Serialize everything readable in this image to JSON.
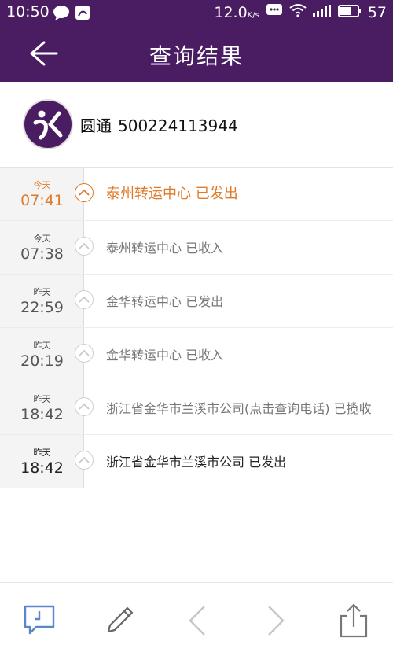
{
  "status": {
    "time": "10:50",
    "speed": "12.0",
    "speed_unit": "K/s",
    "battery": "57"
  },
  "header": {
    "title": "查询结果"
  },
  "carrier": {
    "name": "圆通",
    "tracking_number": "500224113944"
  },
  "events": [
    {
      "day": "今天",
      "time": "07:41",
      "text": "泰州转运中心 已发出"
    },
    {
      "day": "今天",
      "time": "07:38",
      "text": "泰州转运中心 已收入"
    },
    {
      "day": "昨天",
      "time": "22:59",
      "text": "金华转运中心 已发出"
    },
    {
      "day": "昨天",
      "time": "20:19",
      "text": "金华转运中心 已收入"
    },
    {
      "day": "昨天",
      "time": "18:42",
      "text": "浙江省金华市兰溪市公司(点击查询电话) 已揽收"
    },
    {
      "day": "昨天",
      "time": "18:42",
      "text": "浙江省金华市兰溪市公司 已发出"
    }
  ],
  "colors": {
    "brand": "#4a1d63",
    "accent": "#e07a28"
  },
  "icons": {
    "back": "arrow-left-icon",
    "message": "message-icon",
    "edit": "pencil-icon",
    "prev": "chevron-left-icon",
    "next": "chevron-right-icon",
    "share": "share-icon"
  }
}
